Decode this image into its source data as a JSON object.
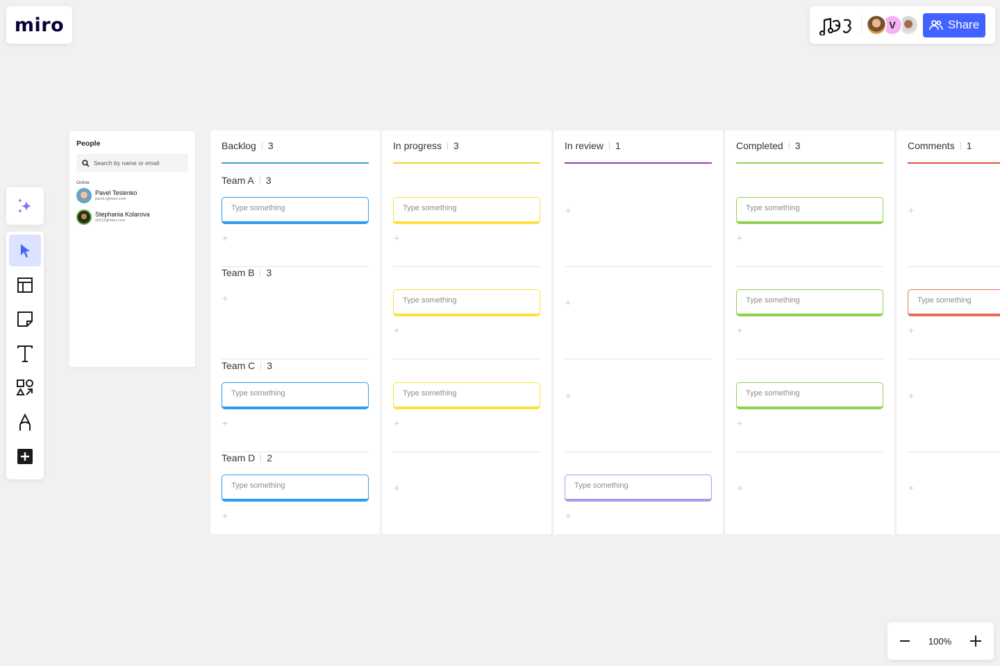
{
  "app": {
    "logo": "miro"
  },
  "topbar": {
    "board_icon": "board-doodle-icon",
    "collaborators": [
      {
        "name": "collaborator-1",
        "initial": ""
      },
      {
        "name": "collaborator-2",
        "initial": "V"
      },
      {
        "name": "collaborator-3",
        "initial": ""
      }
    ],
    "share_label": "Share"
  },
  "toolbar": {
    "ai_tool": "sparkles-icon",
    "tools": [
      {
        "name": "select",
        "icon": "cursor-icon",
        "active": true
      },
      {
        "name": "templates",
        "icon": "layout-icon",
        "active": false
      },
      {
        "name": "sticky-note",
        "icon": "sticky-note-icon",
        "active": false
      },
      {
        "name": "text",
        "icon": "text-icon",
        "active": false
      },
      {
        "name": "shapes",
        "icon": "shapes-icon",
        "active": false
      },
      {
        "name": "pen",
        "icon": "pen-icon",
        "active": false
      },
      {
        "name": "more",
        "icon": "plus-square-icon",
        "active": false
      }
    ]
  },
  "people": {
    "title": "People",
    "search_placeholder": "Search by name or email",
    "online_label": "Online",
    "users": [
      {
        "name": "Pavel Teslenko",
        "email": "pavel.t@miro.com"
      },
      {
        "name": "Stephania Kolarova",
        "email": "s5212@miro.com"
      }
    ]
  },
  "board": {
    "columns": [
      {
        "title": "Backlog",
        "count": "3",
        "color": "#3d9be0"
      },
      {
        "title": "In progress",
        "count": "3",
        "color": "#f5d128"
      },
      {
        "title": "In review",
        "count": "1",
        "color": "#8e3fb0"
      },
      {
        "title": "Completed",
        "count": "3",
        "color": "#8fd14f"
      },
      {
        "title": "Comments",
        "count": "1",
        "color": "#e6533c"
      }
    ],
    "lanes": [
      {
        "title": "Team A",
        "count": "3"
      },
      {
        "title": "Team B",
        "count": "3"
      },
      {
        "title": "Team C",
        "count": "3"
      },
      {
        "title": "Team D",
        "count": "2"
      }
    ],
    "card_placeholder": "Type something",
    "card_colors": {
      "Backlog": "#2d9bf0",
      "In progress": "#fae13c",
      "In review": "#a79cf0",
      "Completed": "#8fd14f",
      "Comments": "#eb6b56"
    },
    "cards": {
      "Team A": [
        true,
        true,
        false,
        true,
        false
      ],
      "Team B": [
        false,
        true,
        false,
        true,
        true
      ],
      "Team C": [
        true,
        true,
        false,
        true,
        false
      ],
      "Team D": [
        true,
        false,
        true,
        false,
        false
      ]
    },
    "add_label": "+"
  },
  "zoom": {
    "level": "100%",
    "zoom_out": "−",
    "zoom_in": "+"
  }
}
